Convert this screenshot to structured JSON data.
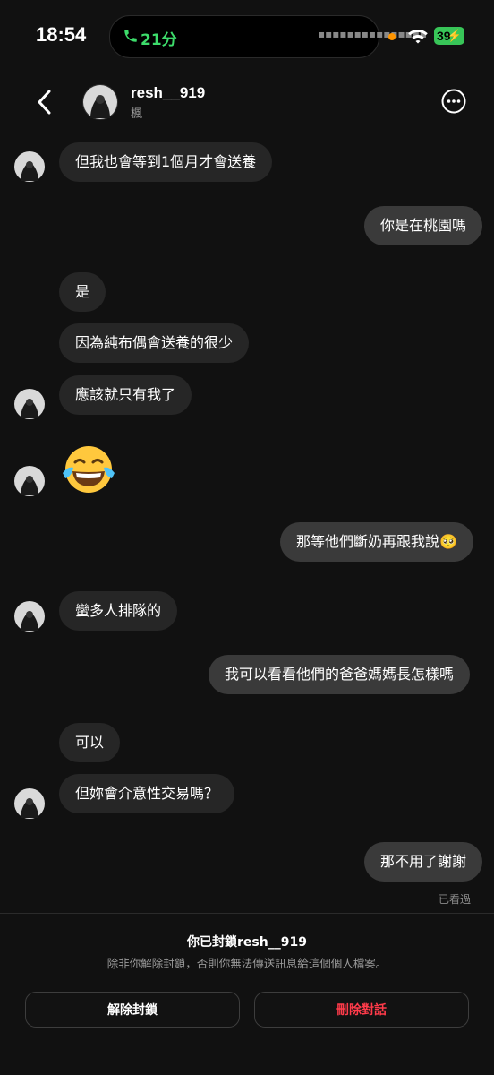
{
  "status_bar": {
    "time": "18:54",
    "call_duration": "21分",
    "battery": "39"
  },
  "header": {
    "username": "resh__919",
    "subtitle": "楓"
  },
  "messages": [
    {
      "side": "them",
      "text": "但我也會等到1個月才會送養"
    },
    {
      "side": "me",
      "text": "你是在桃園嗎"
    },
    {
      "side": "them",
      "text": "是"
    },
    {
      "side": "them",
      "text": "因為純布偶會送養的很少"
    },
    {
      "side": "them",
      "text": "應該就只有我了"
    },
    {
      "side": "them",
      "text": "😂",
      "emoji": "face-with-tears-of-joy"
    },
    {
      "side": "me",
      "text": "那等他們斷奶再跟我說🥺"
    },
    {
      "side": "them",
      "text": "蠻多人排隊的"
    },
    {
      "side": "me",
      "text": "我可以看看他們的爸爸媽媽長怎樣嗎"
    },
    {
      "side": "them",
      "text": "可以"
    },
    {
      "side": "them",
      "text": "但妳會介意性交易嗎？"
    },
    {
      "side": "me",
      "text": "那不用了謝謝"
    }
  ],
  "seen_label": "已看過",
  "block_notice": {
    "title": "你已封鎖resh__919",
    "description": "除非你解除封鎖，否則你無法傳送訊息給這個個人檔案。"
  },
  "actions": {
    "unblock_label": "解除封鎖",
    "delete_label": "刪除對話"
  },
  "colors": {
    "background": "#111111",
    "bubble_them": "#262626",
    "bubble_me": "#3a3a3a",
    "danger": "#ff3b4a",
    "call_green": "#3ddc6b",
    "battery_green": "#38c558"
  }
}
